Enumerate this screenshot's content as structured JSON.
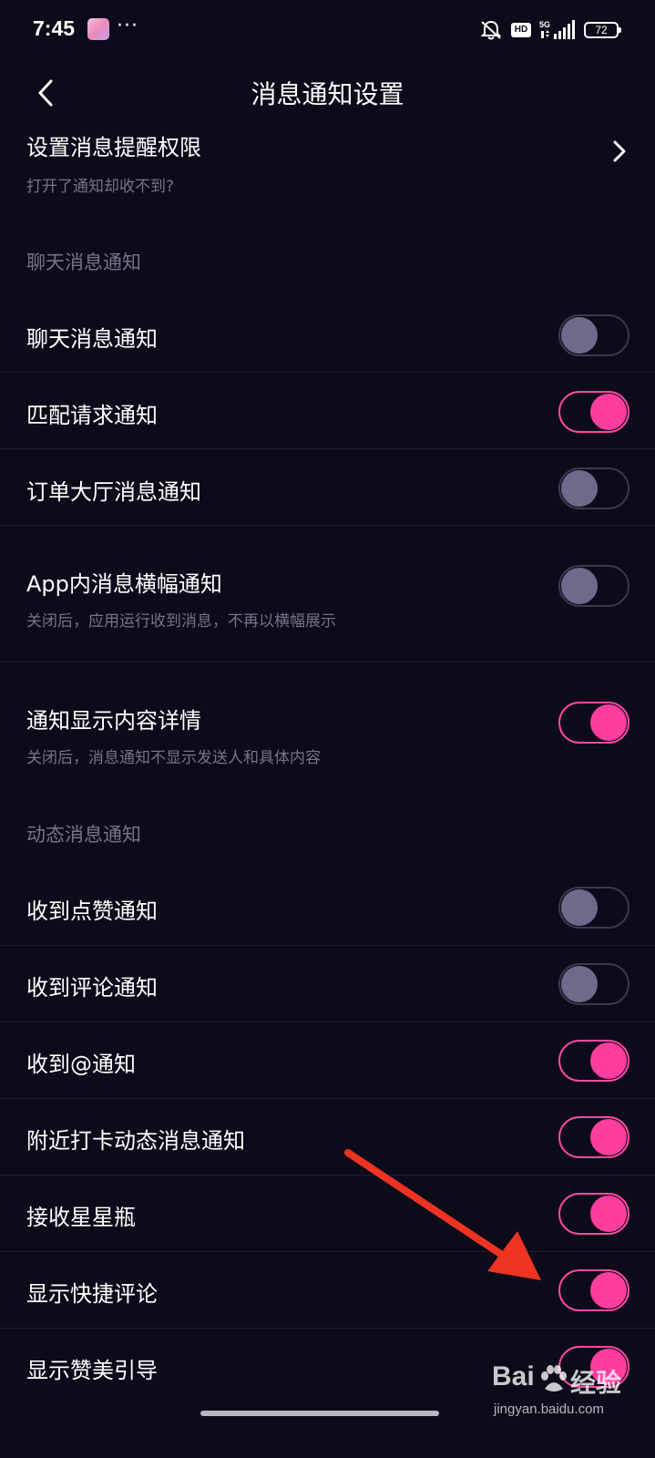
{
  "status_bar": {
    "time": "7:45",
    "dots": "···",
    "hd": "HD",
    "network": "5G",
    "battery": "72"
  },
  "header": {
    "title": "消息通知设置"
  },
  "permission": {
    "title": "设置消息提醒权限",
    "subtitle": "打开了通知却收不到?"
  },
  "sections": {
    "chat": "聊天消息通知",
    "dynamic": "动态消息通知"
  },
  "rows": [
    {
      "label": "聊天消息通知",
      "enabled": false
    },
    {
      "label": "匹配请求通知",
      "enabled": true
    },
    {
      "label": "订单大厅消息通知",
      "enabled": false
    },
    {
      "label": "App内消息横幅通知",
      "sub": "关闭后，应用运行收到消息，不再以横幅展示",
      "enabled": false
    },
    {
      "label": "通知显示内容详情",
      "sub": "关闭后，消息通知不显示发送人和具体内容",
      "enabled": true
    },
    {
      "label": "收到点赞通知",
      "enabled": false
    },
    {
      "label": "收到评论通知",
      "enabled": false
    },
    {
      "label": "收到@通知",
      "enabled": true
    },
    {
      "label": "附近打卡动态消息通知",
      "enabled": true
    },
    {
      "label": "接收星星瓶",
      "enabled": true
    },
    {
      "label": "显示快捷评论",
      "enabled": true
    },
    {
      "label": "显示赞美引导",
      "enabled": true
    }
  ],
  "watermark": {
    "brand": "Bai",
    "brand_cn": "经验",
    "url": "jingyan.baidu.com"
  },
  "colors": {
    "background": "#0c0b19",
    "accent": "#ff3d9e",
    "toggle_off_knob": "#6e6a8c",
    "annotation_arrow": "#ee3322"
  }
}
